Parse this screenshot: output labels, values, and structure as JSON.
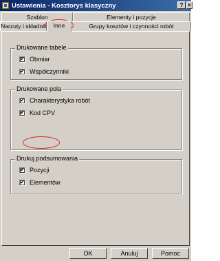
{
  "window": {
    "title": "Ustawienia - Kosztorys klasyczny",
    "help_label": "?",
    "close_label": "×"
  },
  "tabs": {
    "row1": [
      "Szablon",
      "Elementy i pozycje"
    ],
    "row2": [
      "Narzuty i składniki",
      "Inne",
      "Grupy kosztów i czynności robót"
    ],
    "active": "Inne"
  },
  "groups": {
    "drukowane_tabele": {
      "title": "Drukowane tabele",
      "items": [
        {
          "label": "Obmiar",
          "checked": true
        },
        {
          "label": "Współczynniki",
          "checked": true
        }
      ]
    },
    "drukowane_pola": {
      "title": "Drukowane pola",
      "items": [
        {
          "label": "Charakterystyka robót",
          "checked": true
        },
        {
          "label": "Kod CPV",
          "checked": true
        }
      ]
    },
    "drukuj_podsumowania": {
      "title": "Drukuj podsumowania",
      "items": [
        {
          "label": "Pozycji",
          "checked": true
        },
        {
          "label": "Elementów",
          "checked": true
        }
      ]
    }
  },
  "check_glyph": "✔",
  "buttons": {
    "ok": "OK",
    "cancel": "Anuluj",
    "help": "Pomoc"
  },
  "colors": {
    "titlebar": "#0a246a",
    "face": "#d4d0c8",
    "highlight": "#e02020"
  }
}
